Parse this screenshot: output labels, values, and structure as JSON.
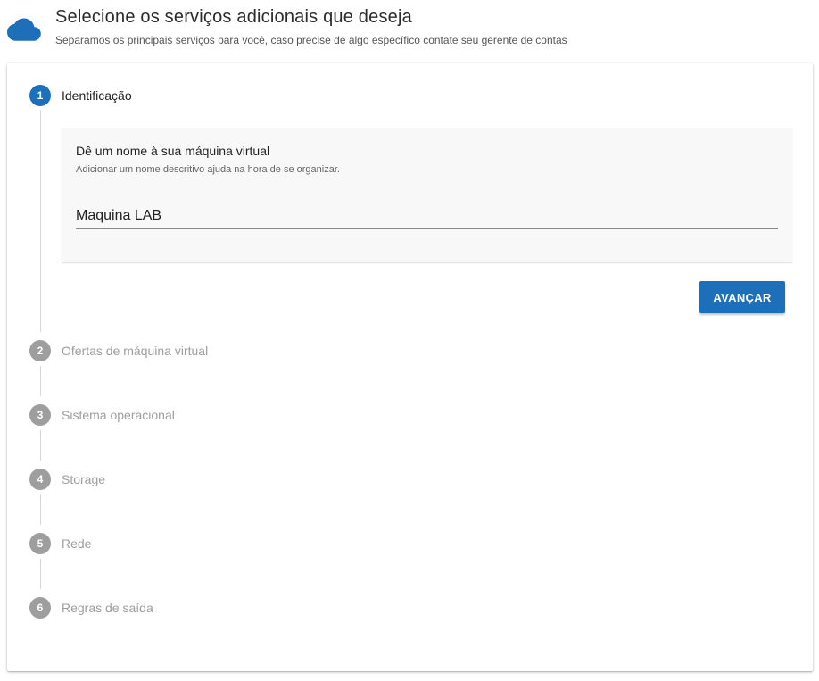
{
  "header": {
    "title": "Selecione os serviços adicionais que deseja",
    "subtitle": "Separamos os principais serviços para você, caso precise de algo específico contate seu gerente de contas",
    "icon": "cloud-icon",
    "icon_color": "#1e6fba"
  },
  "steps": [
    {
      "number": "1",
      "label": "Identificação"
    },
    {
      "number": "2",
      "label": "Ofertas de máquina virtual"
    },
    {
      "number": "3",
      "label": "Sistema operacional"
    },
    {
      "number": "4",
      "label": "Storage"
    },
    {
      "number": "5",
      "label": "Rede"
    },
    {
      "number": "6",
      "label": "Regras de saída"
    }
  ],
  "identification": {
    "title": "Dê um nome à sua máquina virtual",
    "hint": "Adicionar um nome descritivo ajuda na hora de se organizar.",
    "name_value": "Maquina LAB",
    "next_label": "AVANÇAR"
  },
  "colors": {
    "accent": "#1e6fba",
    "inactive_step": "#9e9e9e"
  }
}
